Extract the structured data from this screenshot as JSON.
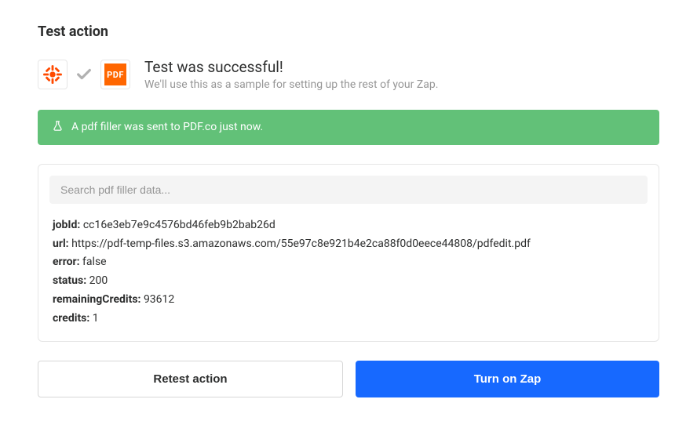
{
  "page": {
    "title": "Test action"
  },
  "header": {
    "title": "Test was successful!",
    "subtitle": "We'll use this as a sample for setting up the rest of your Zap.",
    "pdf_icon_label": "PDF"
  },
  "banner": {
    "message": "A pdf filler was sent to PDF.co just now."
  },
  "search": {
    "placeholder": "Search pdf filler data..."
  },
  "result": {
    "rows": [
      {
        "key": "jobId:",
        "value": "cc16e3eb7e9c4576bd46feb9b2bab26d"
      },
      {
        "key": "url:",
        "value": "https://pdf-temp-files.s3.amazonaws.com/55e97c8e921b4e2ca88f0d0eece44808/pdfedit.pdf"
      },
      {
        "key": "error:",
        "value": "false"
      },
      {
        "key": "status:",
        "value": "200"
      },
      {
        "key": "remainingCredits:",
        "value": "93612"
      },
      {
        "key": "credits:",
        "value": "1"
      }
    ]
  },
  "buttons": {
    "retest": "Retest action",
    "turn_on": "Turn on Zap"
  }
}
